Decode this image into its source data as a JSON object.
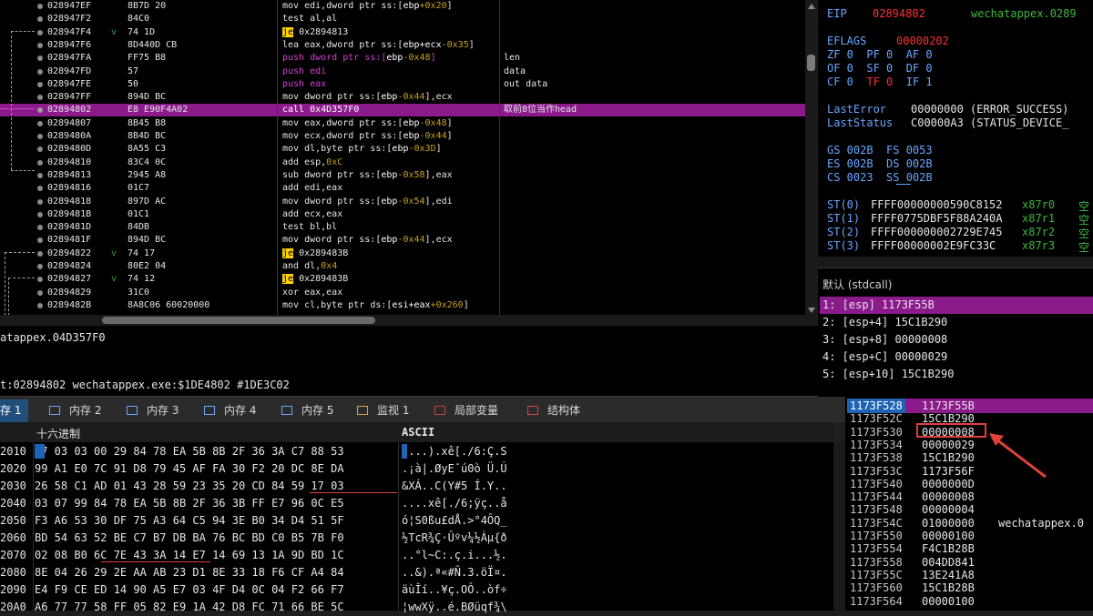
{
  "disasm": {
    "rows": [
      {
        "addr": "028947EF",
        "bytes": "8B7D 20",
        "arrow": "",
        "ins": [
          [
            "plain",
            "mov edi,dword ptr ss:["
          ],
          [
            "reg",
            "ebp"
          ],
          [
            "num",
            "+0x20"
          ],
          [
            "plain",
            "]"
          ]
        ],
        "comment": ""
      },
      {
        "addr": "028947F2",
        "bytes": "84C0",
        "arrow": "",
        "ins": [
          [
            "plain",
            "test al,al"
          ]
        ],
        "comment": ""
      },
      {
        "addr": "028947F4",
        "bytes": "74 1D",
        "arrow": "v",
        "ins": [
          [
            "jmp",
            "je"
          ],
          [
            "plain",
            " 0x2894813"
          ]
        ],
        "comment": ""
      },
      {
        "addr": "028947F6",
        "bytes": "8D440D CB",
        "arrow": "",
        "ins": [
          [
            "plain",
            "lea eax,dword ptr ss:["
          ],
          [
            "reg",
            "ebp+ecx"
          ],
          [
            "num",
            "-0x35"
          ],
          [
            "plain",
            "]"
          ]
        ],
        "comment": ""
      },
      {
        "addr": "028947FA",
        "bytes": "FF75 B8",
        "arrow": "",
        "ins": [
          [
            "push",
            "push dword ptr ss:["
          ],
          [
            "reg",
            "ebp"
          ],
          [
            "num",
            "-0x48"
          ],
          [
            "push",
            "]"
          ]
        ],
        "comment": "len"
      },
      {
        "addr": "028947FD",
        "bytes": "57",
        "arrow": "",
        "ins": [
          [
            "push",
            "push edi"
          ]
        ],
        "comment": "data"
      },
      {
        "addr": "028947FE",
        "bytes": "50",
        "arrow": "",
        "ins": [
          [
            "push",
            "push eax"
          ]
        ],
        "comment": "out data"
      },
      {
        "addr": "028947FF",
        "bytes": "894D BC",
        "arrow": "",
        "ins": [
          [
            "plain",
            "mov dword ptr ss:["
          ],
          [
            "reg",
            "ebp"
          ],
          [
            "num",
            "-0x44"
          ],
          [
            "plain",
            "],ecx"
          ]
        ],
        "comment": ""
      },
      {
        "addr": "02894802",
        "bytes": "E8 E90F4A02",
        "arrow": "",
        "ins": [
          [
            "call",
            "call 0x4D357F0"
          ]
        ],
        "comment": "取前8位当作head",
        "selected": true
      },
      {
        "addr": "02894807",
        "bytes": "8B45 B8",
        "arrow": "",
        "ins": [
          [
            "plain",
            "mov eax,dword ptr ss:["
          ],
          [
            "reg",
            "ebp"
          ],
          [
            "num",
            "-0x48"
          ],
          [
            "plain",
            "]"
          ]
        ],
        "comment": ""
      },
      {
        "addr": "0289480A",
        "bytes": "8B4D BC",
        "arrow": "",
        "ins": [
          [
            "plain",
            "mov ecx,dword ptr ss:["
          ],
          [
            "reg",
            "ebp"
          ],
          [
            "num",
            "-0x44"
          ],
          [
            "plain",
            "]"
          ]
        ],
        "comment": ""
      },
      {
        "addr": "0289480D",
        "bytes": "8A55 C3",
        "arrow": "",
        "ins": [
          [
            "plain",
            "mov dl,byte ptr ss:["
          ],
          [
            "reg",
            "ebp"
          ],
          [
            "num",
            "-0x3D"
          ],
          [
            "plain",
            "]"
          ]
        ],
        "comment": ""
      },
      {
        "addr": "02894810",
        "bytes": "83C4 0C",
        "arrow": "",
        "ins": [
          [
            "plain",
            "add esp,"
          ],
          [
            "num",
            "0xC"
          ]
        ],
        "comment": ""
      },
      {
        "addr": "02894813",
        "bytes": "2945 A8",
        "arrow": "",
        "ins": [
          [
            "plain",
            "sub dword ptr ss:["
          ],
          [
            "reg",
            "ebp"
          ],
          [
            "num",
            "-0x58"
          ],
          [
            "plain",
            "],eax"
          ]
        ],
        "comment": ""
      },
      {
        "addr": "02894816",
        "bytes": "01C7",
        "arrow": "",
        "ins": [
          [
            "plain",
            "add edi,eax"
          ]
        ],
        "comment": ""
      },
      {
        "addr": "02894818",
        "bytes": "897D AC",
        "arrow": "",
        "ins": [
          [
            "plain",
            "mov dword ptr ss:["
          ],
          [
            "reg",
            "ebp"
          ],
          [
            "num",
            "-0x54"
          ],
          [
            "plain",
            "],edi"
          ]
        ],
        "comment": ""
      },
      {
        "addr": "0289481B",
        "bytes": "01C1",
        "arrow": "",
        "ins": [
          [
            "plain",
            "add ecx,eax"
          ]
        ],
        "comment": ""
      },
      {
        "addr": "0289481D",
        "bytes": "84DB",
        "arrow": "",
        "ins": [
          [
            "plain",
            "test bl,bl"
          ]
        ],
        "comment": ""
      },
      {
        "addr": "0289481F",
        "bytes": "894D BC",
        "arrow": "",
        "ins": [
          [
            "plain",
            "mov dword ptr ss:["
          ],
          [
            "reg",
            "ebp"
          ],
          [
            "num",
            "-0x44"
          ],
          [
            "plain",
            "],ecx"
          ]
        ],
        "comment": ""
      },
      {
        "addr": "02894822",
        "bytes": "74 17",
        "arrow": "v",
        "ins": [
          [
            "jmp",
            "je"
          ],
          [
            "plain",
            " 0x289483B"
          ]
        ],
        "comment": ""
      },
      {
        "addr": "02894824",
        "bytes": "80E2 04",
        "arrow": "",
        "ins": [
          [
            "plain",
            "and dl,"
          ],
          [
            "num",
            "0x4"
          ]
        ],
        "comment": ""
      },
      {
        "addr": "02894827",
        "bytes": "74 12",
        "arrow": "v",
        "ins": [
          [
            "jmp",
            "je"
          ],
          [
            "plain",
            " 0x289483B"
          ]
        ],
        "comment": ""
      },
      {
        "addr": "02894829",
        "bytes": "31C0",
        "arrow": "",
        "ins": [
          [
            "plain",
            "xor eax,eax"
          ]
        ],
        "comment": ""
      },
      {
        "addr": "0289482B",
        "bytes": "8A8C06 60020000",
        "arrow": "",
        "ins": [
          [
            "plain",
            "mov cl,byte ptr ds:["
          ],
          [
            "reg",
            "esi+eax"
          ],
          [
            "num",
            "+0x260"
          ],
          [
            "plain",
            "]"
          ]
        ],
        "comment": ""
      }
    ]
  },
  "info": {
    "line1": "atappex.04D357F0",
    "line2": "t:02894802 wechatappex.exe:$1DE4802 #1DE3C02"
  },
  "registers": {
    "eip_label": "EIP",
    "eip_value": "02894802",
    "eip_module": "wechatappex.0289",
    "eflags_label": "EFLAGS",
    "eflags_value": "00000202",
    "flags_row1": "ZF 0  PF 0  AF 0",
    "flags_row2": "OF 0  SF 0  DF 0",
    "flags_row3_a": "CF 0  ",
    "flags_row3_tf": "TF 0",
    "flags_row3_b": "  IF 1",
    "lasterror_label": "LastError",
    "lasterror_value": "00000000 (ERROR_SUCCESS)",
    "laststatus_label": "LastStatus",
    "laststatus_value": "C00000A3 (STATUS_DEVICE_",
    "seg_row1": "GS 002B  FS 0053",
    "seg_row2": "ES 002B  DS 002B",
    "seg_row3": "CS 0023  SS 002B",
    "st": [
      {
        "name": "ST(0)",
        "value": "FFFF00000000590C8152",
        "x": "x87r0",
        "tag": "空"
      },
      {
        "name": "ST(1)",
        "value": "FFFF0775DBF5F88A240A",
        "x": "x87r1",
        "tag": "空"
      },
      {
        "name": "ST(2)",
        "value": "FFFF000000002729E745",
        "x": "x87r2",
        "tag": "空"
      },
      {
        "name": "ST(3)",
        "value": "FFFF00000002E9FC33C",
        "x": "x87r3",
        "tag": "空"
      }
    ]
  },
  "callstack": {
    "title": "默认 (stdcall)",
    "rows": [
      "1: [esp] 1173F55B",
      "2: [esp+4] 15C1B290",
      "3: [esp+8] 00000008",
      "4: [esp+C] 00000029",
      "5: [esp+10] 15C1B290"
    ]
  },
  "tabs": [
    {
      "label": "存 1",
      "active": true
    },
    {
      "label": "内存 2"
    },
    {
      "label": "内存 3"
    },
    {
      "label": "内存 4"
    },
    {
      "label": "内存 5"
    },
    {
      "label": "监视 1"
    },
    {
      "label": "局部变量"
    },
    {
      "label": "结构体"
    }
  ],
  "dump": {
    "hex_header": "十六进制",
    "ascii_header": "ASCII",
    "rows": [
      {
        "addr": "2010",
        "hex": "17 03 03 00 29 84 78 EA 5B 8B 2F 36 3A C7 88 53",
        "ascii": "....).xê[./6:Ç.S"
      },
      {
        "addr": "2020",
        "hex": "99 A1 E0 7C 91 D8 79 45 AF FA 30 F2 20 DC 8E DA",
        "ascii": ".¡à|.ØyE¯ú0ò Ü.Ú"
      },
      {
        "addr": "2030",
        "hex": "26 58 C1 AD 01 43 28 59 23 35 20 CD 84 59 17 03",
        "ascii": "&XÁ..C(Y#5 Í.Y.."
      },
      {
        "addr": "2040",
        "hex": "03 07 99 84 78 EA 5B 8B 2F 36 3B FF E7 96 0C E5",
        "ascii": "....xê[./6;ÿç..å"
      },
      {
        "addr": "2050",
        "hex": "F3 A6 53 30 DF 75 A3 64 C5 94 3E B0 34 D4 51 5F",
        "ascii": "ó¦S0ßu£dÅ.>°4ÔQ_"
      },
      {
        "addr": "2060",
        "hex": "BD 54 63 52 BE C7 B7 DB BA 76 BC BD C0 B5 7B F0",
        "ascii": "½TcR¾Ç·Ûºv¼½Àµ{ð"
      },
      {
        "addr": "2070",
        "hex": "02 08 B0 6C 7E 43 3A 14 E7 14 69 13 1A 9D BD 1C",
        "ascii": "..°l~C:.ç.i...½."
      },
      {
        "addr": "2080",
        "hex": "8E 04 26 29 2E AA AB 23 D1 8E 33 18 F6 CF A4 84",
        "ascii": "..&).ª«#Ñ.3.öÏ¤."
      },
      {
        "addr": "2090",
        "hex": "E4 F9 CE ED 14 90 A5 E7 03 4F D4 0C 04 F2 66 F7",
        "ascii": "äùÎí..¥ç.OÔ..òf÷"
      },
      {
        "addr": "20A0",
        "hex": "A6 77 77 58 FF 05 82 E9 1A 42 D8 FC 71 66 BE 5C",
        "ascii": "¦wwXÿ..é.BØüqf¾\\"
      }
    ]
  },
  "stack": {
    "rows": [
      {
        "addr": "1173F528",
        "val": "1173F55B",
        "comment": "",
        "top": true
      },
      {
        "addr": "1173F52C",
        "val": "15C1B290",
        "comment": ""
      },
      {
        "addr": "1173F530",
        "val": "00000008",
        "comment": ""
      },
      {
        "addr": "1173F534",
        "val": "00000029",
        "comment": ""
      },
      {
        "addr": "1173F538",
        "val": "15C1B290",
        "comment": ""
      },
      {
        "addr": "1173F53C",
        "val": "1173F56F",
        "comment": ""
      },
      {
        "addr": "1173F540",
        "val": "0000000D",
        "comment": ""
      },
      {
        "addr": "1173F544",
        "val": "00000008",
        "comment": ""
      },
      {
        "addr": "1173F548",
        "val": "00000004",
        "comment": ""
      },
      {
        "addr": "1173F54C",
        "val": "01000000",
        "comment": "wechatappex.0"
      },
      {
        "addr": "1173F550",
        "val": "00000100",
        "comment": ""
      },
      {
        "addr": "1173F554",
        "val": "F4C1B28B",
        "comment": ""
      },
      {
        "addr": "1173F558",
        "val": "004DD841",
        "comment": ""
      },
      {
        "addr": "1173F55C",
        "val": "13E241A8",
        "comment": ""
      },
      {
        "addr": "1173F560",
        "val": "15C1B28B",
        "comment": ""
      },
      {
        "addr": "1173F564",
        "val": "00000100",
        "comment": ""
      }
    ]
  },
  "colors": {
    "selection": "#8b1a8b",
    "jump_highlight": "#ffd400",
    "annotation": "#e0403a"
  }
}
